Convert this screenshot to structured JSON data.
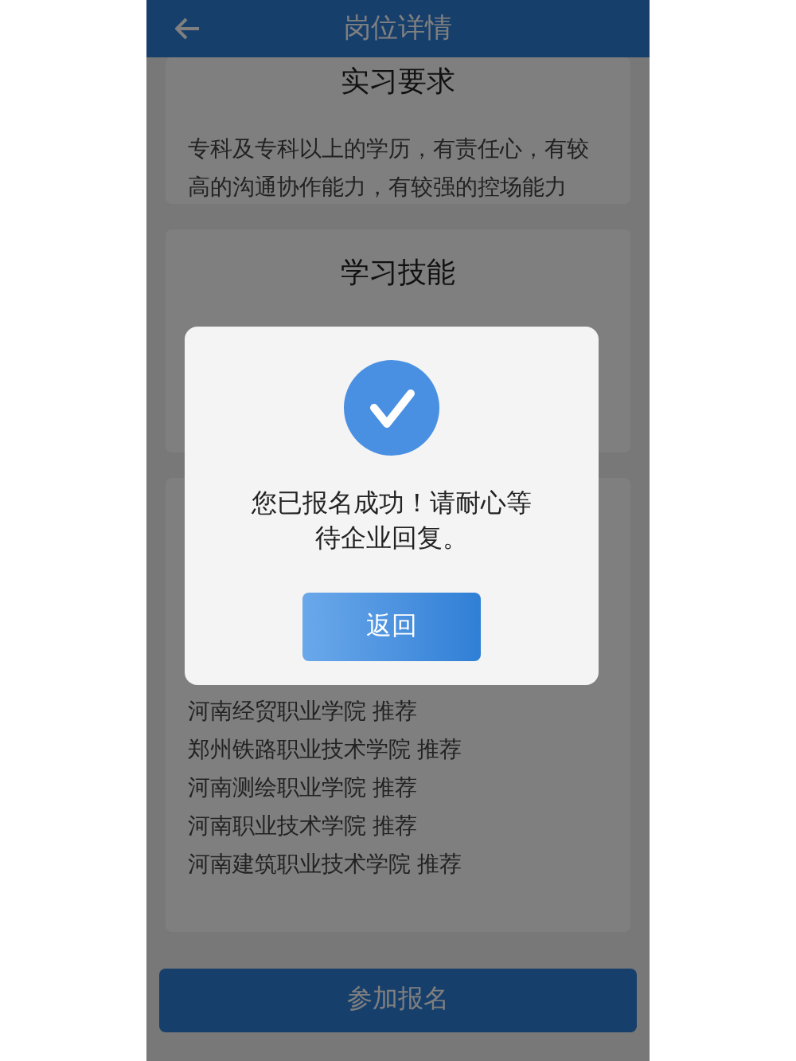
{
  "header": {
    "title": "岗位详情"
  },
  "sections": [
    {
      "title": "实习要求",
      "lines": [
        "专科及专科以上的学历，有责任心，有较高的沟通协作能力，有较强的控场能力"
      ]
    },
    {
      "title": "学习技能"
    },
    {
      "lines": [
        "河南经贸职业学院 推荐",
        "郑州铁路职业技术学院 推荐",
        "河南测绘职业学院 推荐",
        "河南职业技术学院 推荐",
        "河南建筑职业技术学院 推荐"
      ]
    }
  ],
  "apply_button": "参加报名",
  "dialog": {
    "message": "您已报名成功！请耐心等待企业回复。",
    "button": "返回"
  }
}
